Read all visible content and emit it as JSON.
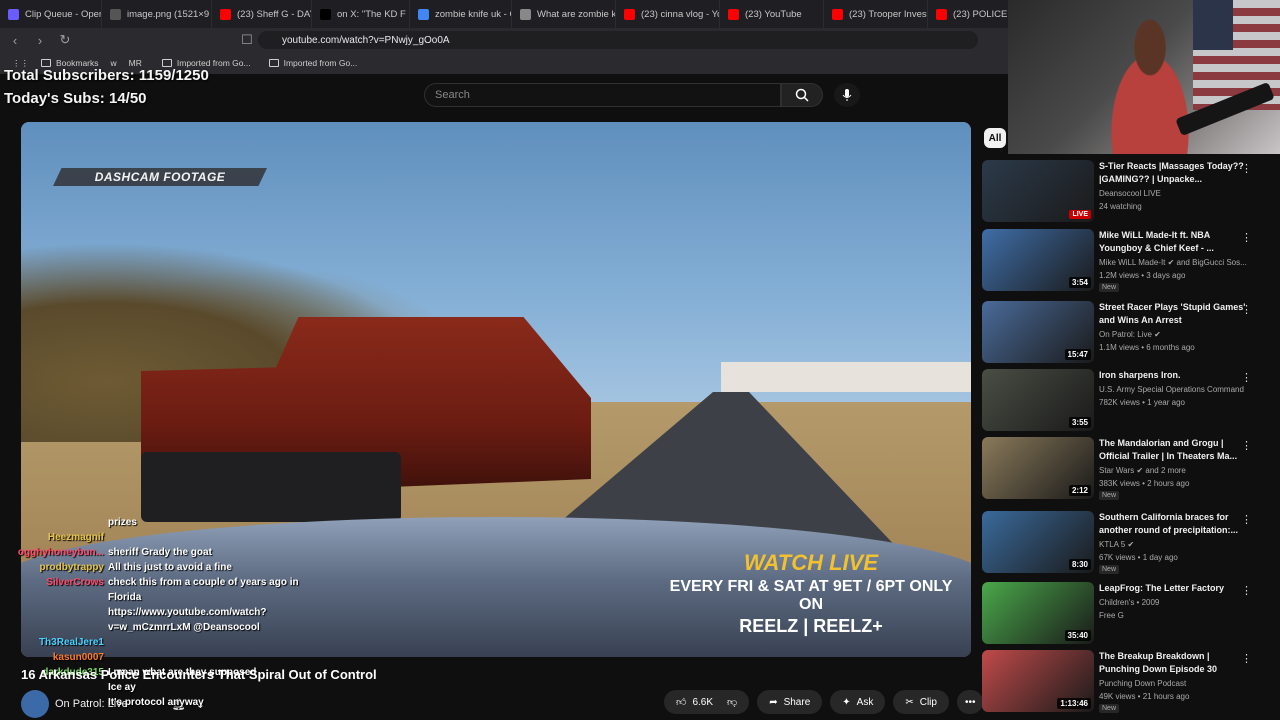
{
  "browser": {
    "tabs": [
      {
        "label": "Clip Queue - Open",
        "icon_color": "#6b5cff"
      },
      {
        "label": "image.png (1521×9",
        "icon_color": "#555"
      },
      {
        "label": "(23) Sheff G - DAY N",
        "icon_color": "#ff0000"
      },
      {
        "label": "on X: \"The KD F",
        "icon_color": "#000"
      },
      {
        "label": "zombie knife uk - G",
        "icon_color": "#4285f4"
      },
      {
        "label": "What are zombie kn",
        "icon_color": "#888"
      },
      {
        "label": "(23) cinna vlog - You",
        "icon_color": "#ff0000"
      },
      {
        "label": "(23) YouTube",
        "icon_color": "#ff0000"
      },
      {
        "label": "(23) Trooper Investi",
        "icon_color": "#ff0000"
      },
      {
        "label": "(23) POLICE V",
        "icon_color": "#ff0000"
      }
    ],
    "url": "youtube.com/watch?v=PNwjy_gOo0A",
    "bookmarks": [
      "Bookmarks",
      "w",
      "MR",
      "Imported from Go...",
      "Imported from Go..."
    ]
  },
  "overlay": {
    "total_subs": "Total Subscribers: 1159/1250",
    "today_subs": "Today's Subs: 14/50"
  },
  "youtube": {
    "search_placeholder": "Search",
    "video": {
      "dashcam_label": "DASHCAM FOOTAGE",
      "promo_line1": "WATCH LIVE",
      "promo_line2": "EVERY FRI & SAT AT 9ET / 6PT ONLY ON",
      "promo_line3": "REELZ | REELZ+"
    },
    "title": "16 Arkansas Police Encounters That Spiral Out of Control",
    "channel": "On Patrol: Live",
    "actions": {
      "likes": "6.6K",
      "share": "Share",
      "ask": "Ask",
      "clip": "Clip"
    },
    "chip": "All",
    "recommendations": [
      {
        "title": "S-Tier Reacts |Massages Today??|GAMING?? | Unpacke...",
        "channel": "Deansocool LIVE",
        "meta": "24 watching",
        "badge": "LIVE",
        "thumb": "#2c3a4a"
      },
      {
        "title": "Mike WiLL Made-It ft. NBA Youngboy & Chief Keef - ...",
        "channel": "Mike WiLL Made-It ✔ and BigGucci Sos...",
        "meta": "1.2M views • 3 days ago",
        "badge": "New",
        "duration": "3:54",
        "thumb": "#3f6ea8"
      },
      {
        "title": "Street Racer Plays 'Stupid Games' and Wins An Arrest",
        "channel": "On Patrol: Live ✔",
        "meta": "1.1M views • 6 months ago",
        "duration": "15:47",
        "thumb": "#4a6b9a"
      },
      {
        "title": "Iron sharpens Iron.",
        "channel": "U.S. Army Special Operations Command",
        "meta": "782K views • 1 year ago",
        "duration": "3:55",
        "thumb": "#4a4e44"
      },
      {
        "title": "The Mandalorian and Grogu | Official Trailer | In Theaters Ma...",
        "channel": "Star Wars ✔ and 2 more",
        "meta": "383K views • 2 hours ago",
        "badge": "New",
        "duration": "2:12",
        "thumb": "#8a7a5a"
      },
      {
        "title": "Southern California braces for another round of precipitation:...",
        "channel": "KTLA 5 ✔",
        "meta": "67K views • 1 day ago",
        "badge": "New",
        "duration": "8:30",
        "thumb": "#3a6a9c"
      },
      {
        "title": "LeapFrog: The Letter Factory",
        "channel": "Children's • 2009",
        "meta": "Free  G",
        "duration": "35:40",
        "thumb": "#4aa84a"
      },
      {
        "title": "The Breakup Breakdown | Punching Down Episode 30",
        "channel": "Punching Down Podcast",
        "meta": "49K views • 21 hours ago",
        "badge": "New",
        "duration": "1:13:46",
        "thumb": "#c04a4a"
      }
    ]
  },
  "chat": [
    {
      "user": "",
      "msg": "prizes",
      "color": "#ffffff"
    },
    {
      "user": "Heezmagnif",
      "msg": "",
      "color": "#e5c44b"
    },
    {
      "user": "ogghyhoneybun...",
      "msg": "sheriff Grady the goat",
      "color": "#ff4b6b"
    },
    {
      "user": "prodbytrappy",
      "msg": "All this just to avoid a fine",
      "color": "#e5c44b"
    },
    {
      "user": "SilverCrows",
      "msg": "check this from a couple of years ago in Florida",
      "color": "#ff4b6b"
    },
    {
      "user": "",
      "msg": "https://www.youtube.com/watch?v=w_mCzmrrLxM @Deansocool",
      "color": "#ffffff"
    },
    {
      "user": "Th3RealJere1",
      "msg": "",
      "color": "#4bd1ff"
    },
    {
      "user": "kasun0007",
      "msg": "",
      "color": "#ff7b2e"
    },
    {
      "user": "darkdude315",
      "msg": "I mean what are they supposed",
      "color": "#7fd86a"
    },
    {
      "user": "",
      "msg": "Ice ay",
      "color": "#ffffff"
    },
    {
      "user": "",
      "msg": "It's protocol anyway",
      "color": "#ffffff"
    }
  ]
}
